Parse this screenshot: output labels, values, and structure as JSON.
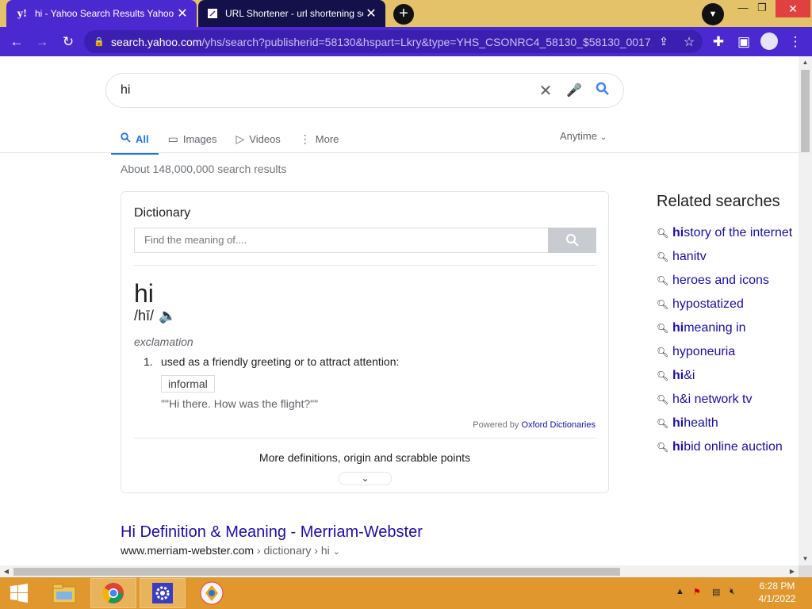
{
  "browser": {
    "tabs": [
      {
        "title": "hi - Yahoo Search Results Yahoo Search",
        "favicon": "y!",
        "active": true
      },
      {
        "title": "URL Shortener - url shortening service",
        "favicon": "link-icon",
        "active": false
      }
    ],
    "address": {
      "host": "search.yahoo.com",
      "path": "/yhs/search?publisherid=58130&hspart=Lkry&type=YHS_CSONRC4_58130_$58130_0017..."
    }
  },
  "search": {
    "query": "hi",
    "tabs": [
      {
        "label": "All",
        "icon": "search-icon"
      },
      {
        "label": "Images",
        "icon": "image-icon"
      },
      {
        "label": "Videos",
        "icon": "play-icon"
      },
      {
        "label": "More",
        "icon": "more-icon"
      }
    ],
    "time_filter": "Anytime",
    "result_count": "About 148,000,000 search results"
  },
  "dictionary": {
    "title": "Dictionary",
    "placeholder": "Find the meaning of....",
    "word": "hi",
    "pronunciation": "/hī/",
    "part_of_speech": "exclamation",
    "definition_number": "1.",
    "definition": "used as a friendly greeting or to attract attention:",
    "tag": "informal",
    "example": "\"\"Hi there. How was the flight?\"\"",
    "powered_prefix": "Powered by",
    "powered_source": "Oxford Dictionaries",
    "more_link": "More definitions, origin and scrabble points"
  },
  "result": {
    "title": "Hi Definition & Meaning - Merriam-Webster",
    "url": "www.merriam-webster.com",
    "crumbs": " › dictionary › hi"
  },
  "related": {
    "title": "Related searches",
    "items": [
      {
        "bold": "hi",
        "rest": "story of the internet"
      },
      {
        "bold": "",
        "rest": "hanitv"
      },
      {
        "bold": "",
        "rest": "heroes and icons"
      },
      {
        "bold": "",
        "rest": "hypostatized"
      },
      {
        "bold": "hi",
        "rest": " meaning in"
      },
      {
        "bold": "",
        "rest": "hyponeuria"
      },
      {
        "bold": "hi",
        "rest": "&i"
      },
      {
        "bold": "",
        "rest": "h&i network tv"
      },
      {
        "bold": "hi",
        "rest": " health"
      },
      {
        "bold": "hi",
        "rest": " bid online auction"
      }
    ]
  },
  "taskbar": {
    "time": "6:28 PM",
    "date": "4/1/2022"
  },
  "colors": {
    "browser_accent": "#4a2ad0",
    "link": "#1a0dab",
    "active_tab": "#1a73e8",
    "taskbar": "#e0982e"
  }
}
